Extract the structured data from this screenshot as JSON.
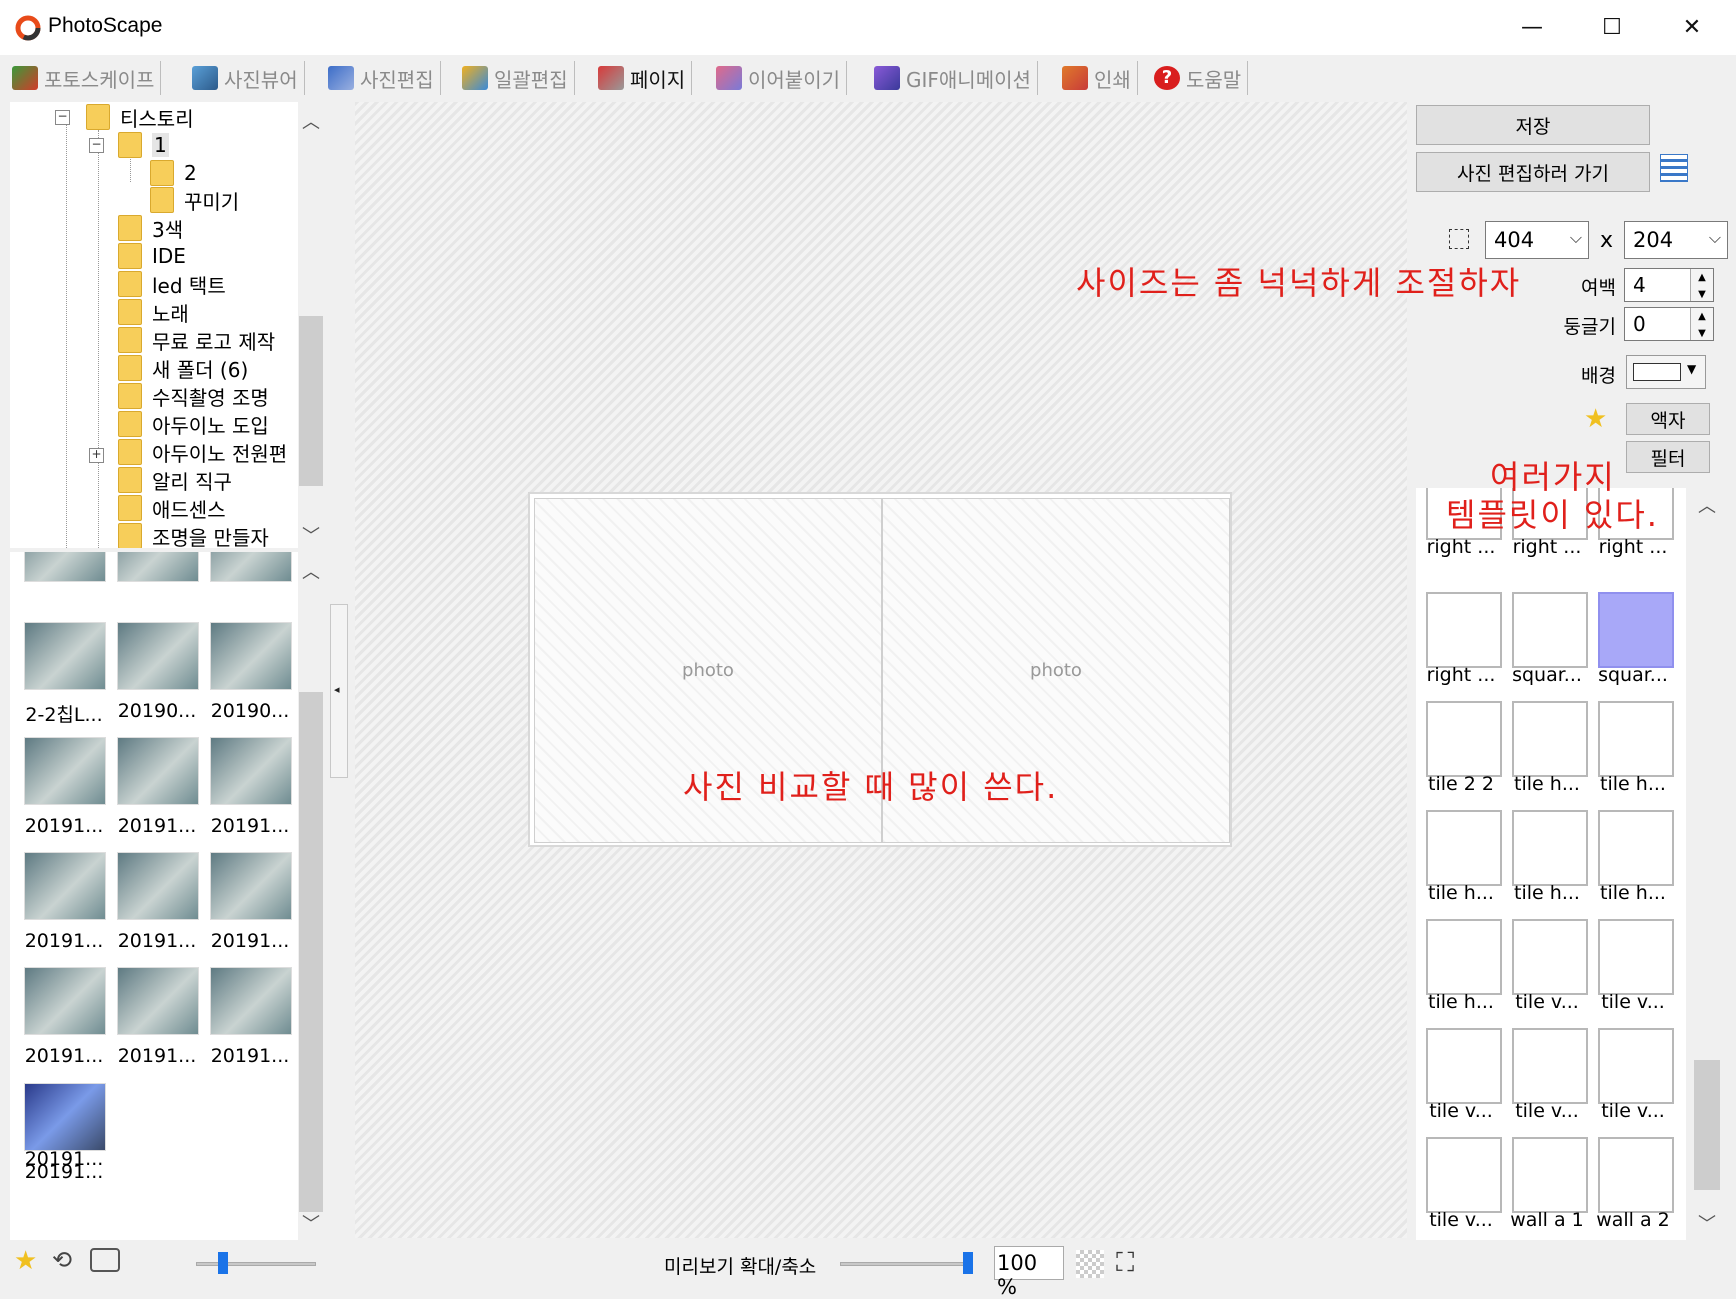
{
  "window": {
    "title": "PhotoScape",
    "min": "—",
    "max": "☐",
    "close": "✕"
  },
  "tabs": [
    {
      "label": "포토스케이프",
      "active": false
    },
    {
      "label": "사진뷰어",
      "active": false
    },
    {
      "label": "사진편집",
      "active": false
    },
    {
      "label": "일괄편집",
      "active": false
    },
    {
      "label": "페이지",
      "active": true
    },
    {
      "label": "이어붙이기",
      "active": false
    },
    {
      "label": "GIF애니메이션",
      "active": false
    },
    {
      "label": "인쇄",
      "active": false
    },
    {
      "label": "도움말",
      "active": false
    }
  ],
  "tree": {
    "items": [
      "티스토리",
      "1",
      "2",
      "꾸미기",
      "3색",
      "IDE",
      "led 택트",
      "노래",
      "무료 로고 제작",
      "새 폴더 (6)",
      "수직촬영 조명",
      "아두이노 도입",
      "아두이노 전원편",
      "알리 직구",
      "애드센스",
      "조명을 만들자"
    ]
  },
  "thumbs": {
    "labels": [
      "2-2칩L...",
      "20190...",
      "20190...",
      "20191...",
      "20191...",
      "20191...",
      "20191...",
      "20191...",
      "20191...",
      "20191...",
      "20191...",
      "20191...",
      "20191...",
      "20191..."
    ]
  },
  "canvas": {
    "cell1": "photo",
    "cell2": "photo"
  },
  "annotations": {
    "size_note": "사이즈는 좀 넉넉하게 조절하자",
    "compare_note": "사진 비교할 때 많이 쓴다.",
    "template_note_1": "여러가지",
    "template_note_2": "템플릿이 있다."
  },
  "right": {
    "save": "저장",
    "goto_edit": "사진 편집하러 가기",
    "width": "404",
    "x": "x",
    "height": "204",
    "margin_label": "여백",
    "margin": "4",
    "round_label": "둥글기",
    "round": "0",
    "bg_label": "배경",
    "frame": "액자",
    "filter": "필터"
  },
  "templates": {
    "labels": [
      "right ...",
      "right ...",
      "right ...",
      "right ...",
      "squar...",
      "squar...",
      "tile 2 2",
      "tile h...",
      "tile h...",
      "tile h...",
      "tile h...",
      "tile h...",
      "tile h...",
      "tile v...",
      "tile v...",
      "tile v...",
      "tile v...",
      "tile v...",
      "tile v...",
      "wall a 1",
      "wall a 2"
    ]
  },
  "status": {
    "zoom_label": "미리보기 확대/축소",
    "zoom_value": "100 %"
  },
  "colors": {
    "annotation": "#e0201b",
    "selected_template": "#a8a8f8"
  }
}
